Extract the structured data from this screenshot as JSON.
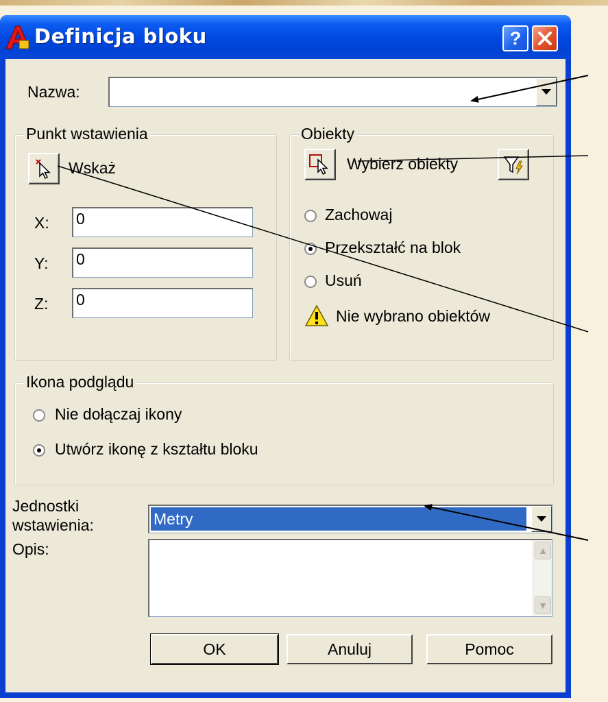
{
  "window": {
    "title": "Definicja bloku",
    "help_glyph": "?",
    "close_glyph": "✕"
  },
  "name_field": {
    "label": "Nazwa:",
    "value": ""
  },
  "insertion_point": {
    "group_title": "Punkt wstawienia",
    "pick_label": "Wskaż",
    "x_label": "X:",
    "x_value": "0",
    "y_label": "Y:",
    "y_value": "0",
    "z_label": "Z:",
    "z_value": "0"
  },
  "objects": {
    "group_title": "Obiekty",
    "select_label": "Wybierz obiekty",
    "options": [
      {
        "label": "Zachowaj",
        "selected": false
      },
      {
        "label": "Przekształć na blok",
        "selected": true
      },
      {
        "label": "Usuń",
        "selected": false
      }
    ],
    "warning_text": "Nie wybrano obiektów"
  },
  "preview_icon": {
    "group_title": "Ikona podglądu",
    "options": [
      {
        "label": "Nie dołączaj ikony",
        "selected": false
      },
      {
        "label": "Utwórz ikonę z kształtu bloku",
        "selected": true
      }
    ]
  },
  "units": {
    "label_line1": "Jednostki",
    "label_line2": "wstawienia:",
    "value": "Metry"
  },
  "description": {
    "label": "Opis:",
    "value": ""
  },
  "buttons": {
    "ok": "OK",
    "cancel": "Anuluj",
    "help": "Pomoc"
  },
  "colors": {
    "title_bar": "#0048e0",
    "dialog_face": "#ece9d8",
    "selection": "#316ac5",
    "close_button": "#e3512c",
    "background": "#f7f1de"
  },
  "icons": [
    "autocad-app-icon",
    "help-icon",
    "close-icon",
    "pick-point-icon",
    "select-objects-icon",
    "quick-select-filter-icon",
    "warning-icon",
    "dropdown-arrow-icon",
    "scroll-up-icon",
    "scroll-down-icon"
  ]
}
